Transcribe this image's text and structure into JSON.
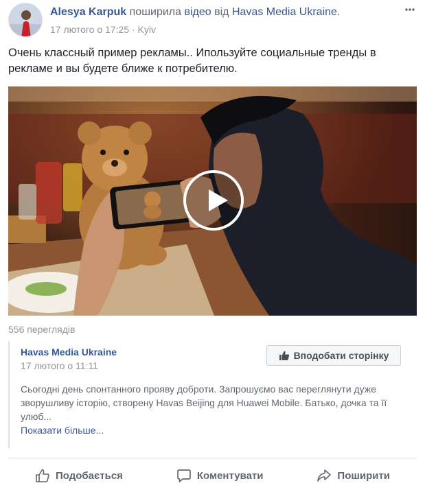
{
  "post": {
    "author": "Alesya Karpuk",
    "shared_text": "поширила",
    "video_link": "відео",
    "from_text": "від",
    "source_page": "Havas Media Ukraine",
    "timestamp": "17 лютого о 17:25",
    "separator": "·",
    "location": "Kyiv",
    "body": "Очень классный пример рекламы.. Ипользуйте социальные тренды в рекламе и вы будете ближе к потребителю."
  },
  "video": {
    "views": "556 переглядів"
  },
  "shared": {
    "page_name": "Havas Media Ukraine",
    "date": "17 лютого о 11:11",
    "like_page_label": "Вподобати сторінку",
    "description": "Сьогодні день спонтанного прояву доброти. Запрошуємо вас переглянути дуже зворушливу історію, створену Havas Beijing для Huawei Mobile. Батько, дочка та її улюб...",
    "see_more": "Показати більше..."
  },
  "actions": {
    "like": "Подобається",
    "comment": "Коментувати",
    "share": "Поширити"
  },
  "icons": {
    "more": "more-horizontal-icon",
    "globe": "globe-icon",
    "thumbs_up": "thumbs-up-icon",
    "comment": "comment-icon",
    "share": "share-arrow-icon",
    "play": "play-icon"
  },
  "colors": {
    "link": "#365899",
    "secondary_text": "#90949c",
    "body_text": "#1d2129",
    "action_text": "#606770",
    "divider": "#dadde1"
  }
}
